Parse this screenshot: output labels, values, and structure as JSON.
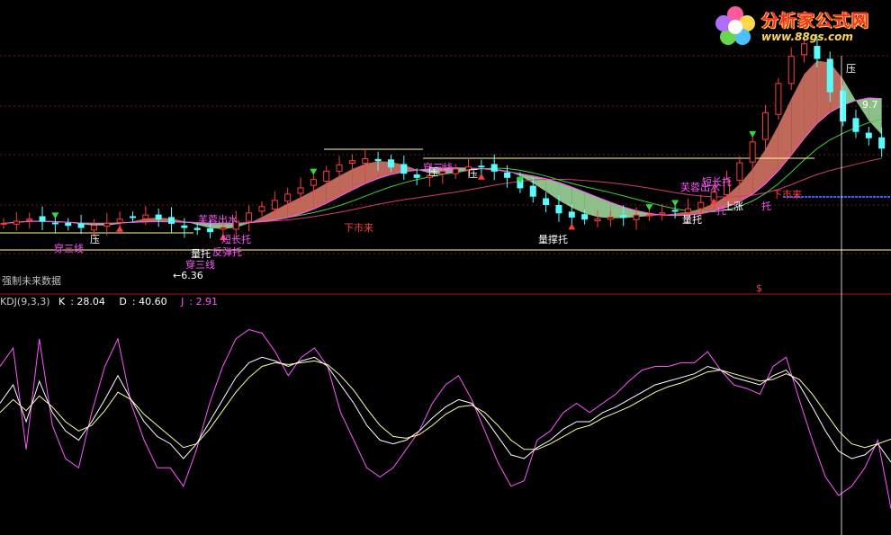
{
  "chart_data": [
    {
      "type": "candlestick",
      "panel": "price",
      "note_text": "强制未来数据",
      "colors": {
        "up": "#ff3c3c",
        "down": "#54ffff",
        "ma_short": "#ff55ff",
        "ma_mid": "#3cd23c",
        "ma_long": "#d23c6e",
        "band_up": "#e07a6a",
        "band_down": "#a6e0a0",
        "level_line": "#ffff9a"
      },
      "closes": [
        9.3,
        9.4,
        9.5,
        9.4,
        9.3,
        9.2,
        9.1,
        9.2,
        9.3,
        9.5,
        9.6,
        9.7,
        9.5,
        9.3,
        9.1,
        9.0,
        8.9,
        9.1,
        9.4,
        9.8,
        10.1,
        10.4,
        10.7,
        11.0,
        11.4,
        11.8,
        12.1,
        12.3,
        12.4,
        12.3,
        12.0,
        11.7,
        11.5,
        11.6,
        11.8,
        11.9,
        12.0,
        12.0,
        11.8,
        11.5,
        11.0,
        10.6,
        10.2,
        9.8,
        9.6,
        9.5,
        9.5,
        9.6,
        9.6,
        9.7,
        9.7,
        9.8,
        9.9,
        10.0,
        10.3,
        10.8,
        11.4,
        12.2,
        13.2,
        14.6,
        16.0,
        17.3,
        17.9,
        17.2,
        15.6,
        14.2,
        13.7,
        13.4,
        12.9
      ],
      "annotations": [
        {
          "text": "压",
          "color": "#ffffff"
        },
        {
          "text": "穿三线",
          "color": "#ff55ff"
        },
        {
          "text": "芙蓉出水",
          "color": "#ff55ff"
        },
        {
          "text": "短长托",
          "color": "#ff55ff"
        },
        {
          "text": "反弹托",
          "color": "#ff55ff"
        },
        {
          "text": "量托",
          "color": "#ffffff"
        },
        {
          "text": "穿三线",
          "color": "#ff55ff"
        },
        {
          "text": "←6.36",
          "color": "#ffffff"
        },
        {
          "text": "下市来",
          "color": "#ff3c3c"
        },
        {
          "text": "穿三线",
          "color": "#ff55ff"
        },
        {
          "text": "压",
          "color": "#ffffff"
        },
        {
          "text": "压",
          "color": "#ffffff"
        },
        {
          "text": "量撑托",
          "color": "#ffffff"
        },
        {
          "text": "芙蓉出水",
          "color": "#ff55ff"
        },
        {
          "text": "短长托",
          "color": "#ff55ff"
        },
        {
          "text": "量托",
          "color": "#ffffff"
        },
        {
          "text": "托",
          "color": "#ff55ff"
        },
        {
          "text": "上涨",
          "color": "#ffffff"
        },
        {
          "text": "托",
          "color": "#ff55ff"
        },
        {
          "text": "下市来",
          "color": "#ff3c3c"
        },
        {
          "text": "压",
          "color": "#ffffff"
        },
        {
          "text": "9.7",
          "color": "#ffffff"
        },
        {
          "text": "$",
          "color": "#ff3c3c"
        }
      ]
    },
    {
      "type": "line",
      "panel": "indicator",
      "title_text": "KDJ(9,3,3)",
      "legend": [
        {
          "name": "K",
          "value": "28.04",
          "color": "#ffffff"
        },
        {
          "name": "D",
          "value": "40.60",
          "color": "#ffff00"
        },
        {
          "name": "J",
          "value": "2.91",
          "color": "#ff55ff"
        }
      ],
      "ylim": [
        -10,
        110
      ],
      "series": [
        {
          "name": "K",
          "values": [
            60,
            70,
            50,
            72,
            55,
            45,
            40,
            50,
            62,
            75,
            62,
            50,
            42,
            38,
            30,
            38,
            50,
            62,
            74,
            82,
            85,
            83,
            80,
            83,
            85,
            80,
            70,
            60,
            48,
            40,
            38,
            40,
            45,
            52,
            58,
            62,
            60,
            52,
            42,
            32,
            30,
            36,
            40,
            46,
            50,
            50,
            55,
            58,
            62,
            66,
            70,
            72,
            74,
            76,
            80,
            78,
            74,
            72,
            70,
            75,
            78,
            70,
            58,
            45,
            34,
            30,
            32,
            38,
            28.04
          ]
        },
        {
          "name": "D",
          "values": [
            55,
            62,
            56,
            64,
            58,
            50,
            45,
            48,
            56,
            66,
            62,
            54,
            48,
            42,
            36,
            38,
            46,
            56,
            66,
            74,
            80,
            82,
            81,
            82,
            83,
            81,
            75,
            67,
            57,
            48,
            42,
            41,
            43,
            48,
            54,
            58,
            59,
            55,
            48,
            40,
            35,
            35,
            38,
            42,
            46,
            48,
            52,
            55,
            58,
            62,
            66,
            69,
            71,
            74,
            77,
            78,
            76,
            74,
            72,
            73,
            76,
            73,
            65,
            55,
            45,
            38,
            36,
            38,
            40.6
          ]
        },
        {
          "name": "J",
          "values": [
            80,
            90,
            35,
            95,
            48,
            30,
            25,
            55,
            80,
            95,
            60,
            40,
            25,
            25,
            15,
            35,
            60,
            80,
            95,
            100,
            98,
            88,
            75,
            85,
            90,
            80,
            55,
            40,
            25,
            20,
            25,
            35,
            45,
            60,
            70,
            75,
            62,
            45,
            28,
            15,
            18,
            40,
            45,
            55,
            60,
            55,
            60,
            65,
            72,
            78,
            80,
            80,
            82,
            82,
            88,
            78,
            70,
            68,
            65,
            80,
            85,
            62,
            40,
            20,
            10,
            15,
            25,
            40,
            2.91
          ]
        }
      ]
    }
  ],
  "logo": {
    "name": "分析家公式网",
    "url": "www.88gs.com"
  }
}
